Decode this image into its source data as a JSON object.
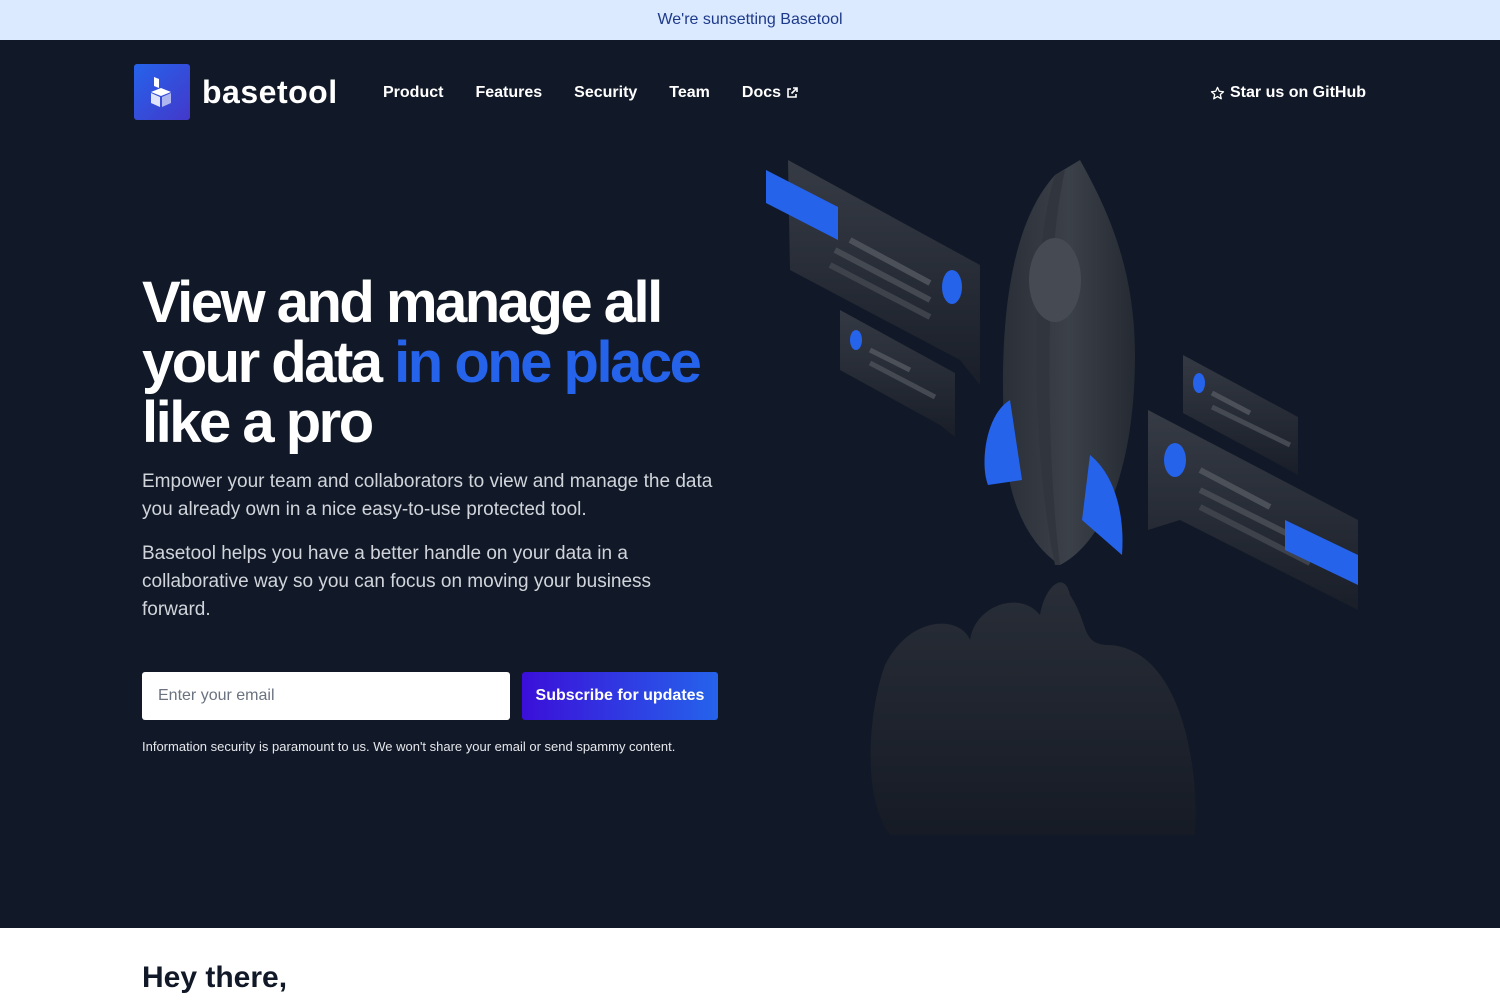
{
  "banner": {
    "text": "We're sunsetting Basetool"
  },
  "brand": {
    "name": "basetool",
    "logo_icon": "basetool-logo-icon"
  },
  "nav": {
    "items": [
      {
        "label": "Product"
      },
      {
        "label": "Features"
      },
      {
        "label": "Security"
      },
      {
        "label": "Team"
      },
      {
        "label": "Docs",
        "icon": "external-link-icon"
      }
    ],
    "github_label": "Star us on GitHub",
    "github_icon": "star-icon"
  },
  "hero": {
    "headline_line1": "View and manage all",
    "headline_line2_start": "your data ",
    "headline_line2_accent": "in one place",
    "headline_line3": "like a pro",
    "paragraph1": "Empower your team and collaborators to view and manage the data you already own in a nice easy-to-use protected tool.",
    "paragraph2": "Basetool helps you have a better handle on your data in a collaborative way so you can focus on moving your business forward.",
    "email_placeholder": "Enter your email",
    "subscribe_label": "Subscribe for updates",
    "disclaimer": "Information security is paramount to us. We won't share your email or send spammy content."
  },
  "section": {
    "heading": "Hey there,"
  },
  "colors": {
    "background": "#111827",
    "accent": "#2563eb",
    "banner_bg": "#dbeafe",
    "banner_text": "#1e3a8a"
  }
}
